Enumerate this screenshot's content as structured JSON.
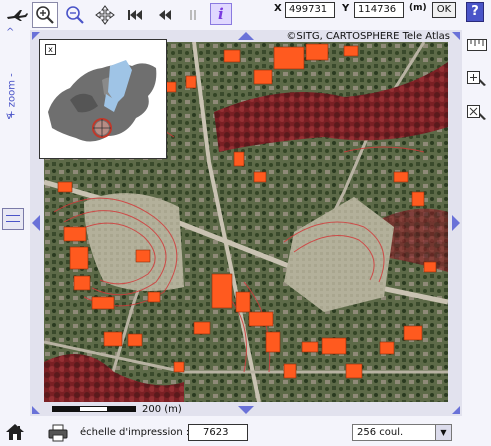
{
  "toolbar": {
    "tools": [
      {
        "name": "zoom-in-tool",
        "icon": "zoom-in-icon",
        "active": true
      },
      {
        "name": "zoom-out-tool",
        "icon": "zoom-out-icon",
        "active": false
      },
      {
        "name": "pan-tool",
        "icon": "pan-move-icon",
        "active": false
      },
      {
        "name": "first-view-tool",
        "icon": "first-view-icon",
        "active": false
      },
      {
        "name": "previous-view-tool",
        "icon": "previous-view-icon",
        "active": false
      },
      {
        "name": "next-view-tool",
        "icon": "next-view-icon",
        "active": false
      },
      {
        "name": "info-tool",
        "icon": "info-icon",
        "active": false
      }
    ],
    "x_label": "X",
    "x_value": "499731",
    "y_label": "Y",
    "y_value": "114736",
    "unit_label": "(m)",
    "ok_label": "OK",
    "help_label": "?"
  },
  "zoom_rail": {
    "label": "+ zoom -",
    "up_chevron": "^",
    "down_chevron": "v"
  },
  "map": {
    "copyright": "©SITG, CARTOSPHERE Tele Atlas",
    "scale_label": "200 (m)",
    "colors": {
      "buildings": "#ff5a1f",
      "contours": "#d23a3a",
      "vegetation": "#2e4a22",
      "fields": "#b0ad98",
      "accent": "#4a54c8"
    }
  },
  "inset": {
    "close_label": "x",
    "water_color": "#9fc4e6",
    "canton_color": "#6f6f6f"
  },
  "right_tools": [
    {
      "name": "measure-tool",
      "icon": "ruler-icon"
    },
    {
      "name": "zoom-box-tool",
      "icon": "zoom-box-icon"
    },
    {
      "name": "clear-tool",
      "icon": "clear-box-icon"
    }
  ],
  "bottom": {
    "print_scale_label": "échelle d'impression :",
    "print_scale_value": "7623",
    "color_mode": "256 coul."
  }
}
